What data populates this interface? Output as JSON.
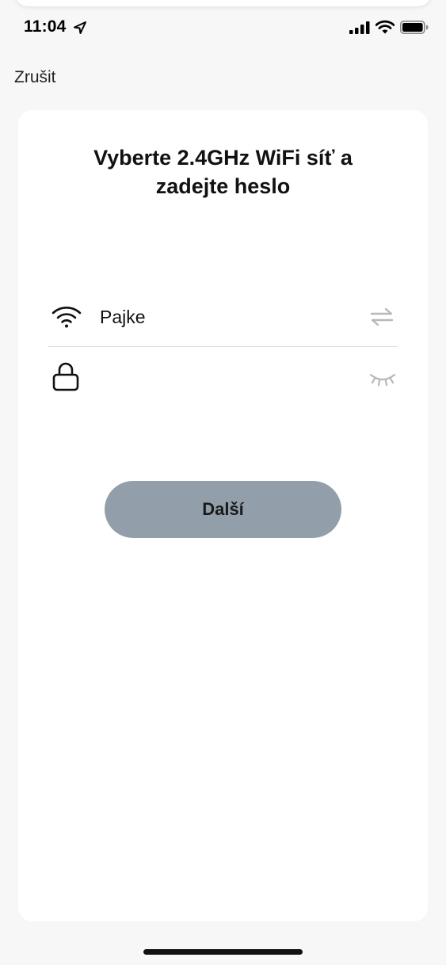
{
  "status_bar": {
    "time": "11:04",
    "location_icon": "location-arrow-icon",
    "signal_icon": "cellular-signal-icon",
    "wifi_icon": "wifi-icon",
    "battery_icon": "battery-full-icon"
  },
  "nav": {
    "cancel_label": "Zrušit"
  },
  "card": {
    "title_line1": "Vyberte 2.4GHz WiFi síť a",
    "title_line2": "zadejte heslo",
    "ssid": {
      "icon": "wifi-icon",
      "value": "Pajke",
      "switch_icon": "swap-arrows-icon"
    },
    "password": {
      "icon": "lock-icon",
      "value": "",
      "placeholder": "",
      "toggle_icon": "eye-closed-icon"
    },
    "next_label": "Další"
  },
  "colors": {
    "background": "#f7f7f7",
    "card": "#ffffff",
    "button": "#929fab",
    "icon_muted": "#b8b8b8"
  }
}
